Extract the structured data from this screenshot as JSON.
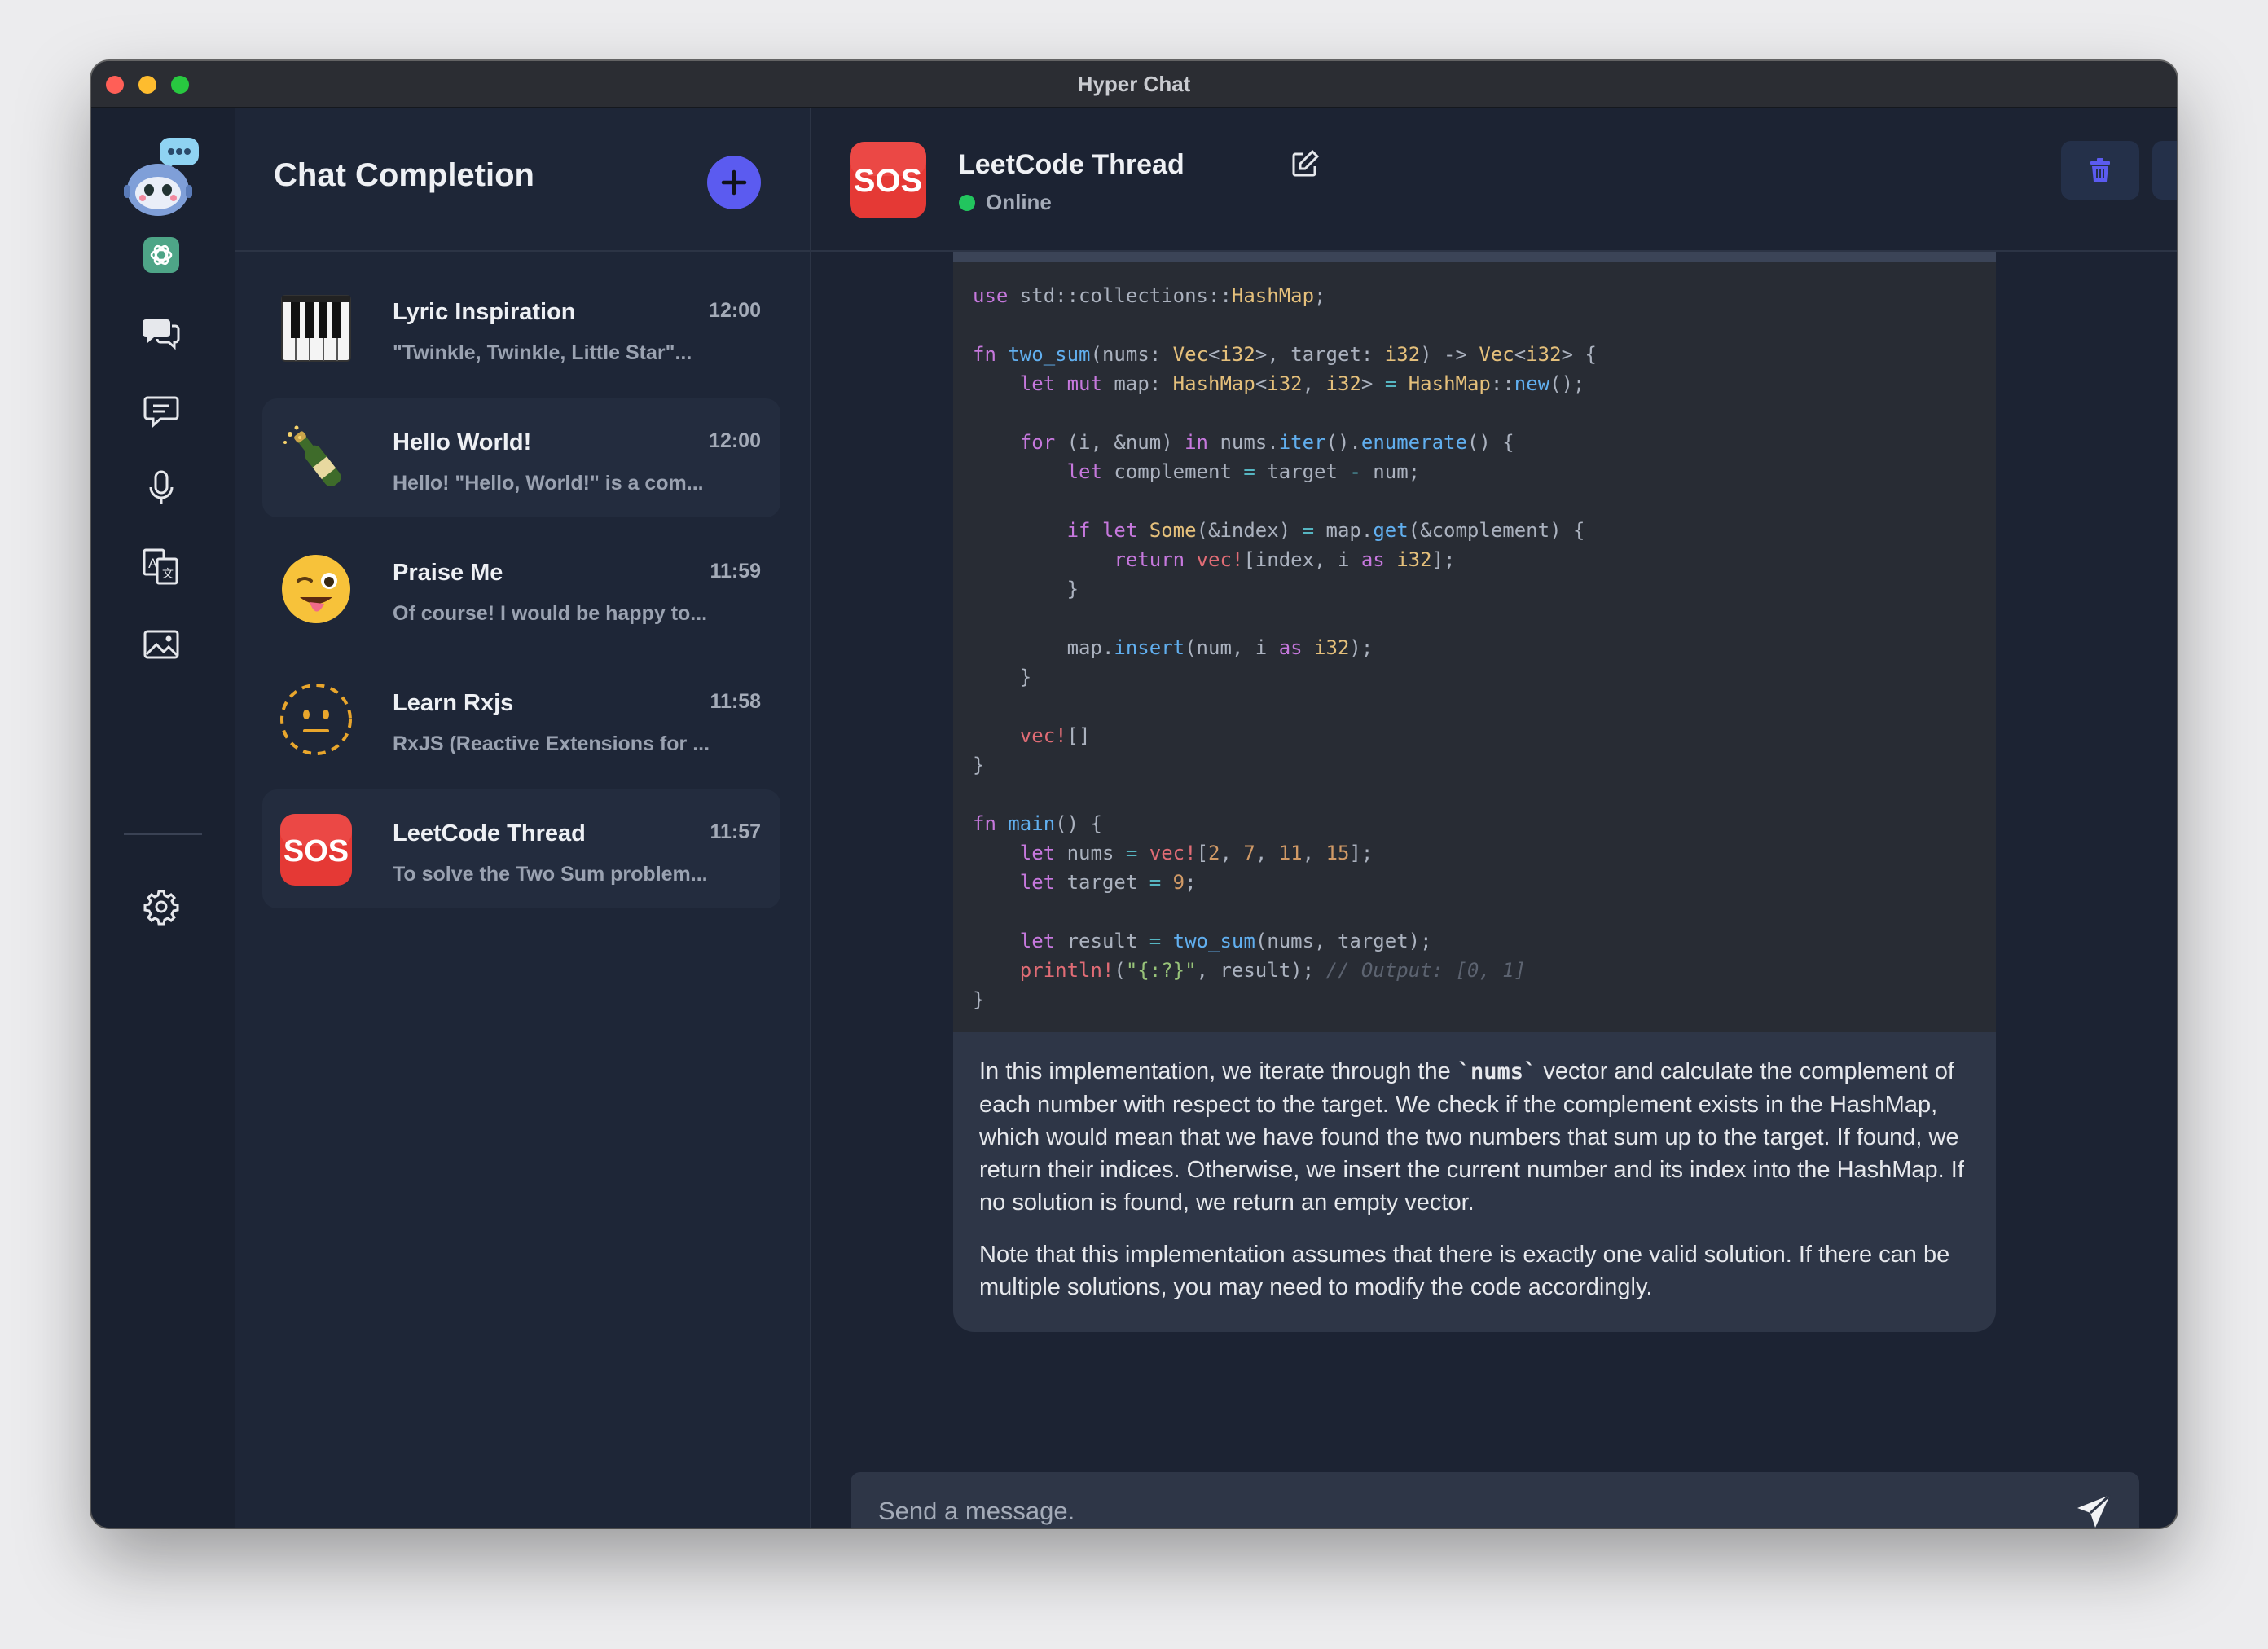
{
  "window": {
    "title": "Hyper Chat"
  },
  "rail": {
    "items": [
      {
        "icon": "openai-icon",
        "label": "ChatGPT"
      },
      {
        "icon": "chat-bubbles-icon",
        "label": "Chat Completion"
      },
      {
        "icon": "message-icon",
        "label": "Message"
      },
      {
        "icon": "microphone-icon",
        "label": "Audio"
      },
      {
        "icon": "translate-icon",
        "label": "Translate"
      },
      {
        "icon": "image-icon",
        "label": "Image"
      }
    ],
    "settings_icon": "gear-icon"
  },
  "list": {
    "title": "Chat Completion",
    "chats": [
      {
        "name": "Lyric Inspiration",
        "time": "12:00",
        "preview": "\"Twinkle, Twinkle, Little Star\"...",
        "avatar": "piano-icon",
        "active": false
      },
      {
        "name": "Hello World!",
        "time": "12:00",
        "preview": "Hello! \"Hello, World!\" is a com...",
        "avatar": "champagne-icon",
        "active": true
      },
      {
        "name": "Praise Me",
        "time": "11:59",
        "preview": "Of course! I would be happy to...",
        "avatar": "winking-tongue-emoji",
        "active": false
      },
      {
        "name": "Learn Rxjs",
        "time": "11:58",
        "preview": "RxJS (Reactive Extensions for ...",
        "avatar": "dotted-face-emoji",
        "active": false
      },
      {
        "name": "LeetCode Thread",
        "time": "11:57",
        "preview": "To solve the Two Sum problem...",
        "avatar": "sos-icon",
        "active": true
      }
    ]
  },
  "main": {
    "title": "LeetCode Thread",
    "avatar_text": "SOS",
    "status": "Online",
    "message": {
      "paragraph1_before": "In this implementation, we iterate through the ",
      "paragraph1_code": "`nums`",
      "paragraph1_after": " vector and calculate the complement of each number with respect to the target. We check if the complement exists in the HashMap, which would mean that we have found the two numbers that sum up to the target. If found, we return their indices. Otherwise, we insert the current number and its index into the HashMap. If no solution is found, we return an empty vector.",
      "paragraph2": "Note that this implementation assumes that there is exactly one valid solution. If there can be multiple solutions, you may need to modify the code accordingly."
    },
    "composer": {
      "placeholder": "Send a message."
    }
  },
  "colors": {
    "accent": "#5b5bf0",
    "online": "#22c55e",
    "sos_red": "#e53935",
    "background": "#1c2333"
  }
}
